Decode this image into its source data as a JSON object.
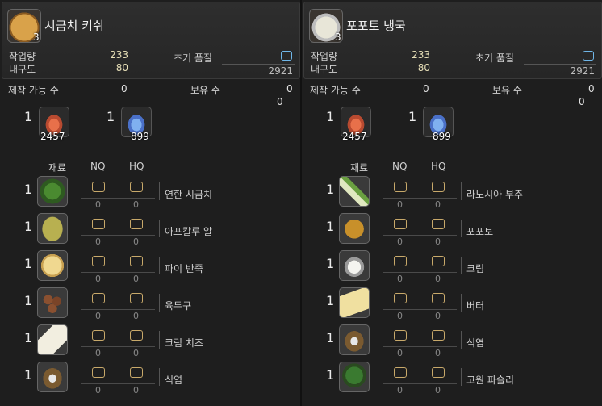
{
  "panels": [
    {
      "item_name": "시금치 키쉬",
      "item_count": "3",
      "icon": "quiche-icon",
      "stats": {
        "workload_label": "작업량",
        "workload_value": "233",
        "durability_label": "내구도",
        "durability_value": "80",
        "quality_label": "초기 품질",
        "quality_value": "2921"
      },
      "craftable_label": "제작 가능 수",
      "craftable_value": "0",
      "owned_label": "보유 수",
      "owned_value": "0",
      "owned_sub": "0",
      "crystals": [
        {
          "count": "1",
          "qty": "2457",
          "icon": "fire-crystal-icon"
        },
        {
          "count": "1",
          "qty": "899",
          "icon": "water-crystal-icon"
        }
      ],
      "col_material": "재료",
      "col_nq": "NQ",
      "col_hq": "HQ",
      "materials": [
        {
          "count": "1",
          "name": "연한 시금치",
          "nq": "0",
          "hq": "0",
          "icon": "spinach-icon"
        },
        {
          "count": "1",
          "name": "아프칼루 알",
          "nq": "0",
          "hq": "0",
          "icon": "egg-icon"
        },
        {
          "count": "1",
          "name": "파이 반죽",
          "nq": "0",
          "hq": "0",
          "icon": "pie-dough-icon"
        },
        {
          "count": "1",
          "name": "육두구",
          "nq": "0",
          "hq": "0",
          "icon": "nutmeg-icon"
        },
        {
          "count": "1",
          "name": "크림 치즈",
          "nq": "0",
          "hq": "0",
          "icon": "cream-cheese-icon"
        },
        {
          "count": "1",
          "name": "식염",
          "nq": "0",
          "hq": "0",
          "icon": "salt-icon"
        }
      ]
    },
    {
      "item_name": "포포토 냉국",
      "item_count": "3",
      "icon": "soup-icon",
      "stats": {
        "workload_label": "작업량",
        "workload_value": "233",
        "durability_label": "내구도",
        "durability_value": "80",
        "quality_label": "초기 품질",
        "quality_value": "2921"
      },
      "craftable_label": "제작 가능 수",
      "craftable_value": "0",
      "owned_label": "보유 수",
      "owned_value": "0",
      "owned_sub": "0",
      "crystals": [
        {
          "count": "1",
          "qty": "2457",
          "icon": "fire-crystal-icon"
        },
        {
          "count": "1",
          "qty": "899",
          "icon": "water-crystal-icon"
        }
      ],
      "col_material": "재료",
      "col_nq": "NQ",
      "col_hq": "HQ",
      "materials": [
        {
          "count": "1",
          "name": "라노시아 부추",
          "nq": "0",
          "hq": "0",
          "icon": "leek-icon"
        },
        {
          "count": "1",
          "name": "포포토",
          "nq": "0",
          "hq": "0",
          "icon": "popoto-icon"
        },
        {
          "count": "1",
          "name": "크림",
          "nq": "0",
          "hq": "0",
          "icon": "cream-icon"
        },
        {
          "count": "1",
          "name": "버터",
          "nq": "0",
          "hq": "0",
          "icon": "butter-icon"
        },
        {
          "count": "1",
          "name": "식염",
          "nq": "0",
          "hq": "0",
          "icon": "salt-icon"
        },
        {
          "count": "1",
          "name": "고원 파슬리",
          "nq": "0",
          "hq": "0",
          "icon": "parsley-icon"
        }
      ]
    }
  ],
  "colors": {
    "hq_box": "#6fb6e8",
    "nq_box": "#c8a96a",
    "stat_value": "#e8e0b8"
  }
}
